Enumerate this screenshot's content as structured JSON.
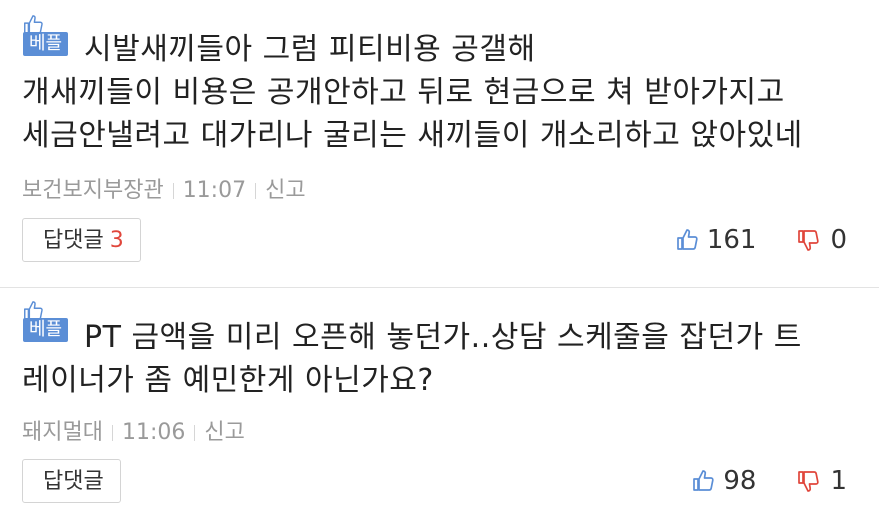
{
  "comments": [
    {
      "badge": "베플",
      "text_lines": [
        "시발새끼들아 그럼 피티비용 공갤해",
        "개새끼들이 비용은 공개안하고 뒤로 현금으로 쳐 받아가지고",
        "세금안낼려고 대가리나 굴리는 새끼들이 개소리하고 앉아있네"
      ],
      "author": "보건보지부장관",
      "time": "11:07",
      "report_label": "신고",
      "reply_label": "답댓글",
      "reply_count": "3",
      "likes": "161",
      "dislikes": "0"
    },
    {
      "badge": "베플",
      "text_lines": [
        "PT 금액을 미리 오픈해 놓던가..상담 스케줄을 잡던가 트",
        "레이너가 좀 예민한게 아닌가요?"
      ],
      "author": "돼지멀대",
      "time": "11:06",
      "report_label": "신고",
      "reply_label": "답댓글",
      "likes": "98",
      "dislikes": "1"
    }
  ],
  "colors": {
    "badge_bg": "#5b8ed6",
    "thumb_up": "#5b8ed6",
    "thumb_down": "#e0463b",
    "reply_count": "#e0463b",
    "meta_text": "#9a9a9a"
  },
  "icons": {
    "badge_icon": "thumbs-up-icon",
    "like_icon": "thumbs-up-icon",
    "dislike_icon": "thumbs-down-icon"
  }
}
